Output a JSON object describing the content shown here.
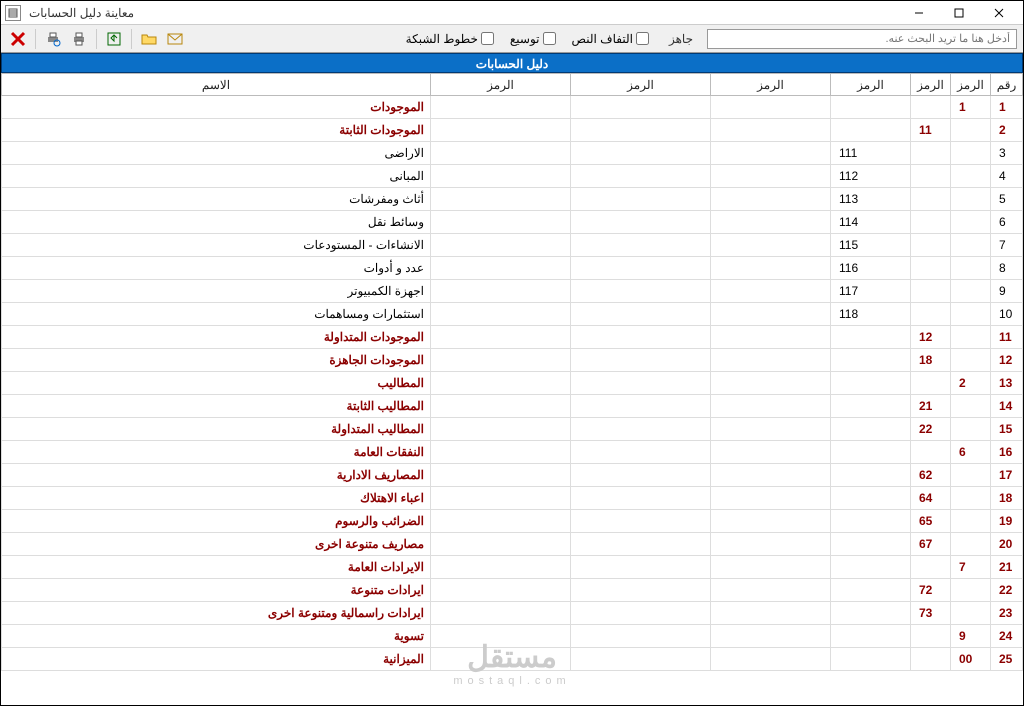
{
  "window": {
    "title": "معاينة دليل الحسابات"
  },
  "toolbar": {
    "search_placeholder": "أدخل هنا ما تريد البحث عنه.",
    "status": "جاهز",
    "check_wrap": "التفاف النص",
    "check_expand": "توسيع",
    "check_grid": "خطوط الشبكة"
  },
  "band": {
    "title": "دليل الحسابات"
  },
  "columns": {
    "rn": "رقم",
    "c1": "الرمز",
    "c2": "الرمز",
    "c3": "الرمز",
    "c4": "الرمز",
    "c5": "الرمز",
    "c6": "الرمز",
    "name": "الاسم"
  },
  "rows": [
    {
      "rn": "1",
      "c1": "1",
      "c2": "",
      "c3": "",
      "name": "الموجودات",
      "bold": true
    },
    {
      "rn": "2",
      "c1": "",
      "c2": "11",
      "c3": "",
      "name": "الموجودات الثابتة",
      "bold": true
    },
    {
      "rn": "3",
      "c1": "",
      "c2": "",
      "c3": "111",
      "name": "الاراضى"
    },
    {
      "rn": "4",
      "c1": "",
      "c2": "",
      "c3": "112",
      "name": "المبانى"
    },
    {
      "rn": "5",
      "c1": "",
      "c2": "",
      "c3": "113",
      "name": "أثاث ومفرشات"
    },
    {
      "rn": "6",
      "c1": "",
      "c2": "",
      "c3": "114",
      "name": "وسائط نقل"
    },
    {
      "rn": "7",
      "c1": "",
      "c2": "",
      "c3": "115",
      "name": "الانشاءات - المستودعات"
    },
    {
      "rn": "8",
      "c1": "",
      "c2": "",
      "c3": "116",
      "name": "عدد و أدوات"
    },
    {
      "rn": "9",
      "c1": "",
      "c2": "",
      "c3": "117",
      "name": "اجهزة الكمبيوتر"
    },
    {
      "rn": "10",
      "c1": "",
      "c2": "",
      "c3": "118",
      "name": "استثمارات ومساهمات"
    },
    {
      "rn": "11",
      "c1": "",
      "c2": "12",
      "c3": "",
      "name": "الموجودات المتداولة",
      "bold": true
    },
    {
      "rn": "12",
      "c1": "",
      "c2": "18",
      "c3": "",
      "name": "الموجودات الجاهزة",
      "bold": true
    },
    {
      "rn": "13",
      "c1": "2",
      "c2": "",
      "c3": "",
      "name": "المطاليب",
      "bold": true
    },
    {
      "rn": "14",
      "c1": "",
      "c2": "21",
      "c3": "",
      "name": "المطاليب الثابتة",
      "bold": true
    },
    {
      "rn": "15",
      "c1": "",
      "c2": "22",
      "c3": "",
      "name": "المطاليب المتداولة",
      "bold": true
    },
    {
      "rn": "16",
      "c1": "6",
      "c2": "",
      "c3": "",
      "name": "النفقات العامة",
      "bold": true
    },
    {
      "rn": "17",
      "c1": "",
      "c2": "62",
      "c3": "",
      "name": "المصاريف الادارية",
      "bold": true
    },
    {
      "rn": "18",
      "c1": "",
      "c2": "64",
      "c3": "",
      "name": "اعباء الاهتلاك",
      "bold": true
    },
    {
      "rn": "19",
      "c1": "",
      "c2": "65",
      "c3": "",
      "name": "الضرائب والرسوم",
      "bold": true
    },
    {
      "rn": "20",
      "c1": "",
      "c2": "67",
      "c3": "",
      "name": "مصاريف متنوعة اخرى",
      "bold": true
    },
    {
      "rn": "21",
      "c1": "7",
      "c2": "",
      "c3": "",
      "name": "الايرادات العامة",
      "bold": true
    },
    {
      "rn": "22",
      "c1": "",
      "c2": "72",
      "c3": "",
      "name": "ايرادات متنوعة",
      "bold": true
    },
    {
      "rn": "23",
      "c1": "",
      "c2": "73",
      "c3": "",
      "name": "ايرادات راسمالية ومتنوعة اخرى",
      "bold": true
    },
    {
      "rn": "24",
      "c1": "9",
      "c2": "",
      "c3": "",
      "name": "تسوية",
      "bold": true
    },
    {
      "rn": "25",
      "c1": "00",
      "c2": "",
      "c3": "",
      "name": "الميزانية",
      "bold": true
    }
  ],
  "watermark": {
    "ar": "مستقل",
    "en": "mostaql.com"
  }
}
